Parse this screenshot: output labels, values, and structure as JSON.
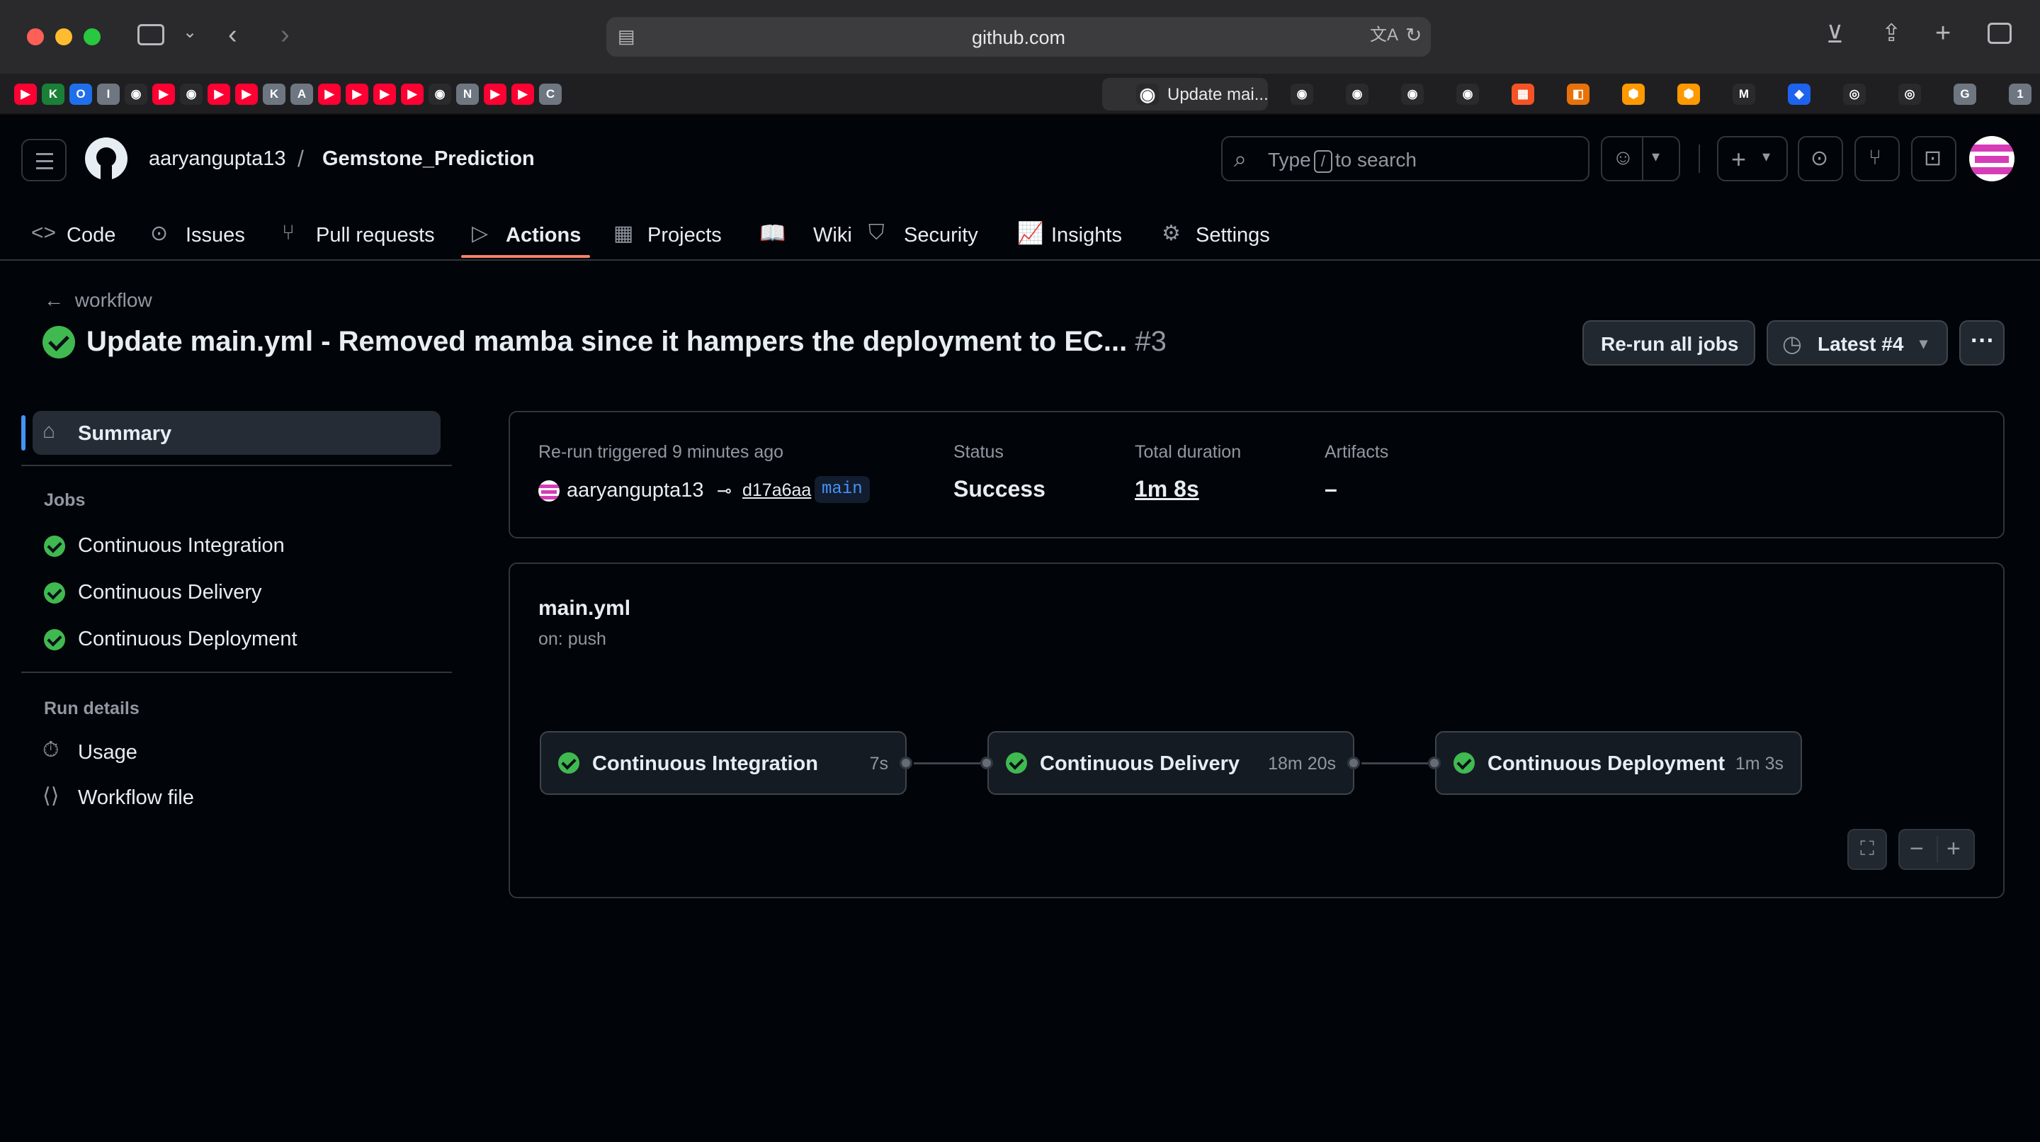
{
  "browser": {
    "url": "github.com",
    "active_tab_title": "Update mai..."
  },
  "favorites": [
    {
      "name": "youtube",
      "color": "#ff0033",
      "glyph": "▶"
    },
    {
      "name": "k",
      "color": "#1a7f37",
      "glyph": "K"
    },
    {
      "name": "o",
      "color": "#1f6feb",
      "glyph": "O"
    },
    {
      "name": "i",
      "color": "#6e7681",
      "glyph": "I"
    },
    {
      "name": "github",
      "color": "#2a2a2c",
      "glyph": "◉"
    },
    {
      "name": "youtube",
      "color": "#ff0033",
      "glyph": "▶"
    },
    {
      "name": "github",
      "color": "#2a2a2c",
      "glyph": "◉"
    },
    {
      "name": "youtube",
      "color": "#ff0033",
      "glyph": "▶"
    },
    {
      "name": "youtube",
      "color": "#ff0033",
      "glyph": "▶"
    },
    {
      "name": "k",
      "color": "#6e7681",
      "glyph": "K"
    },
    {
      "name": "a",
      "color": "#6e7681",
      "glyph": "A"
    },
    {
      "name": "youtube",
      "color": "#ff0033",
      "glyph": "▶"
    },
    {
      "name": "youtube",
      "color": "#ff0033",
      "glyph": "▶"
    },
    {
      "name": "youtube",
      "color": "#ff0033",
      "glyph": "▶"
    },
    {
      "name": "youtube",
      "color": "#ff0033",
      "glyph": "▶"
    },
    {
      "name": "github",
      "color": "#2a2a2c",
      "glyph": "◉"
    },
    {
      "name": "n",
      "color": "#6e7681",
      "glyph": "N"
    },
    {
      "name": "youtube",
      "color": "#ff0033",
      "glyph": "▶"
    },
    {
      "name": "youtube",
      "color": "#ff0033",
      "glyph": "▶"
    },
    {
      "name": "c",
      "color": "#6e7681",
      "glyph": "C"
    }
  ],
  "favorites_right": [
    {
      "name": "github",
      "color": "#2a2a2c",
      "glyph": "◉"
    },
    {
      "name": "github",
      "color": "#2a2a2c",
      "glyph": "◉"
    },
    {
      "name": "github",
      "color": "#2a2a2c",
      "glyph": "◉"
    },
    {
      "name": "github",
      "color": "#2a2a2c",
      "glyph": "◉"
    },
    {
      "name": "microsoft",
      "color": "#f35325",
      "glyph": "▦"
    },
    {
      "name": "orange-app",
      "color": "#e8710a",
      "glyph": "◧"
    },
    {
      "name": "aws",
      "color": "#ff9900",
      "glyph": "⬢"
    },
    {
      "name": "aws",
      "color": "#ff9900",
      "glyph": "⬢"
    },
    {
      "name": "gmail",
      "color": "#2a2a2c",
      "glyph": "M"
    },
    {
      "name": "docker",
      "color": "#1d63ed",
      "glyph": "◆"
    },
    {
      "name": "digital",
      "color": "#2a2a2c",
      "glyph": "◎"
    },
    {
      "name": "digital",
      "color": "#2a2a2c",
      "glyph": "◎"
    },
    {
      "name": "g",
      "color": "#6e7681",
      "glyph": "G"
    },
    {
      "name": "one",
      "color": "#6e7681",
      "glyph": "1"
    }
  ],
  "header": {
    "owner": "aaryangupta13",
    "separator": "/",
    "repo": "Gemstone_Prediction",
    "search_prefix": "Type",
    "search_key": "/",
    "search_suffix": "to search"
  },
  "tabs": [
    {
      "label": "Code",
      "icon": "code-icon",
      "glyph": "<>"
    },
    {
      "label": "Issues",
      "icon": "issue-icon",
      "glyph": "⊙"
    },
    {
      "label": "Pull requests",
      "icon": "pull-request-icon",
      "glyph": "⑂"
    },
    {
      "label": "Actions",
      "icon": "play-icon",
      "glyph": "▷"
    },
    {
      "label": "Projects",
      "icon": "table-icon",
      "glyph": "▦"
    },
    {
      "label": "Wiki",
      "icon": "book-icon",
      "glyph": "📖"
    },
    {
      "label": "Security",
      "icon": "shield-icon",
      "glyph": "⛉"
    },
    {
      "label": "Insights",
      "icon": "graph-icon",
      "glyph": "📈"
    },
    {
      "label": "Settings",
      "icon": "gear-icon",
      "glyph": "⚙"
    }
  ],
  "run": {
    "back_label": "workflow",
    "title": "Update main.yml - Removed mamba since it hampers the deployment to EC...",
    "number": "#3",
    "rerun_label": "Re-run all jobs",
    "latest_label": "Latest #4"
  },
  "sidebar": {
    "summary_label": "Summary",
    "jobs_heading": "Jobs",
    "jobs": [
      "Continuous Integration",
      "Continuous Delivery",
      "Continuous Deployment"
    ],
    "run_details_heading": "Run details",
    "usage_label": "Usage",
    "workflow_file_label": "Workflow file"
  },
  "summary": {
    "trigger_label": "Re-run triggered",
    "trigger_time": "9 minutes ago",
    "actor": "aaryangupta13",
    "commit": "d17a6aa",
    "branch": "main",
    "status_label": "Status",
    "status_value": "Success",
    "duration_label": "Total duration",
    "duration_value": "1m 8s",
    "artifacts_label": "Artifacts",
    "artifacts_value": "–"
  },
  "workflow": {
    "file": "main.yml",
    "trigger": "on: push",
    "jobs": [
      {
        "name": "Continuous Integration",
        "duration": "7s"
      },
      {
        "name": "Continuous Delivery",
        "duration": "18m 20s"
      },
      {
        "name": "Continuous Deployment",
        "duration": "1m 3s"
      }
    ]
  },
  "colors": {
    "success": "#3fb950",
    "accent": "#4493f8",
    "active_tab": "#f78166"
  }
}
